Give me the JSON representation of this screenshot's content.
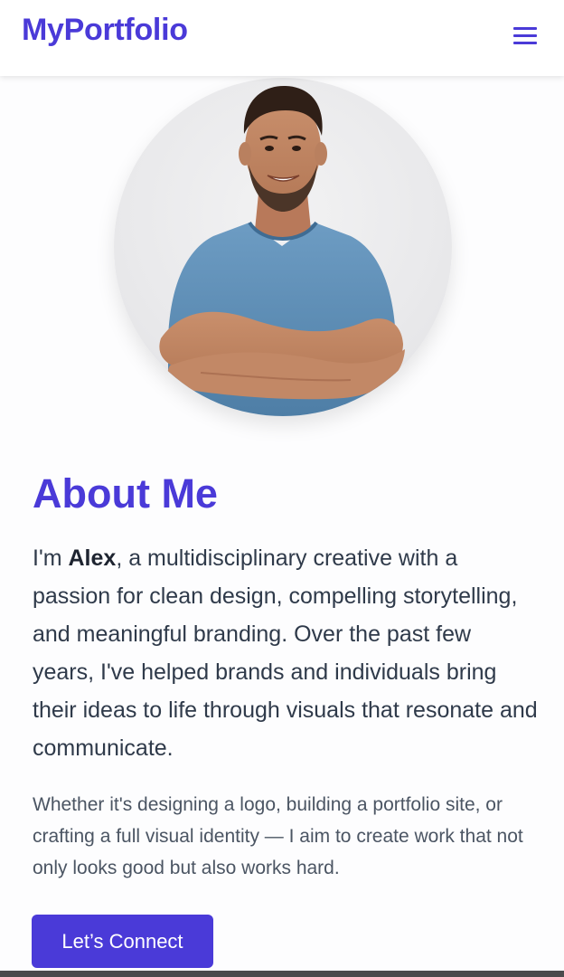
{
  "header": {
    "logo": "MyPortfolio",
    "menu_icon": "hamburger-menu-icon"
  },
  "profile": {
    "image_description": "profile-photo"
  },
  "about": {
    "title": "About Me",
    "para1_prefix": "I'm ",
    "name": "Alex",
    "para1_suffix": ", a multidisciplinary creative with a passion for clean design, compelling storytelling, and meaningful branding. Over the past few years, I've helped brands and individuals bring their ideas to life through visuals that resonate and communicate.",
    "para2": "Whether it's designing a logo, building a portfolio site, or crafting a full visual identity — I aim to create work that not only looks good but also works hard.",
    "cta_label": "Let’s Connect"
  },
  "colors": {
    "accent": "#4a3ad8",
    "text": "#2f3a4a",
    "muted": "#4b5563"
  }
}
